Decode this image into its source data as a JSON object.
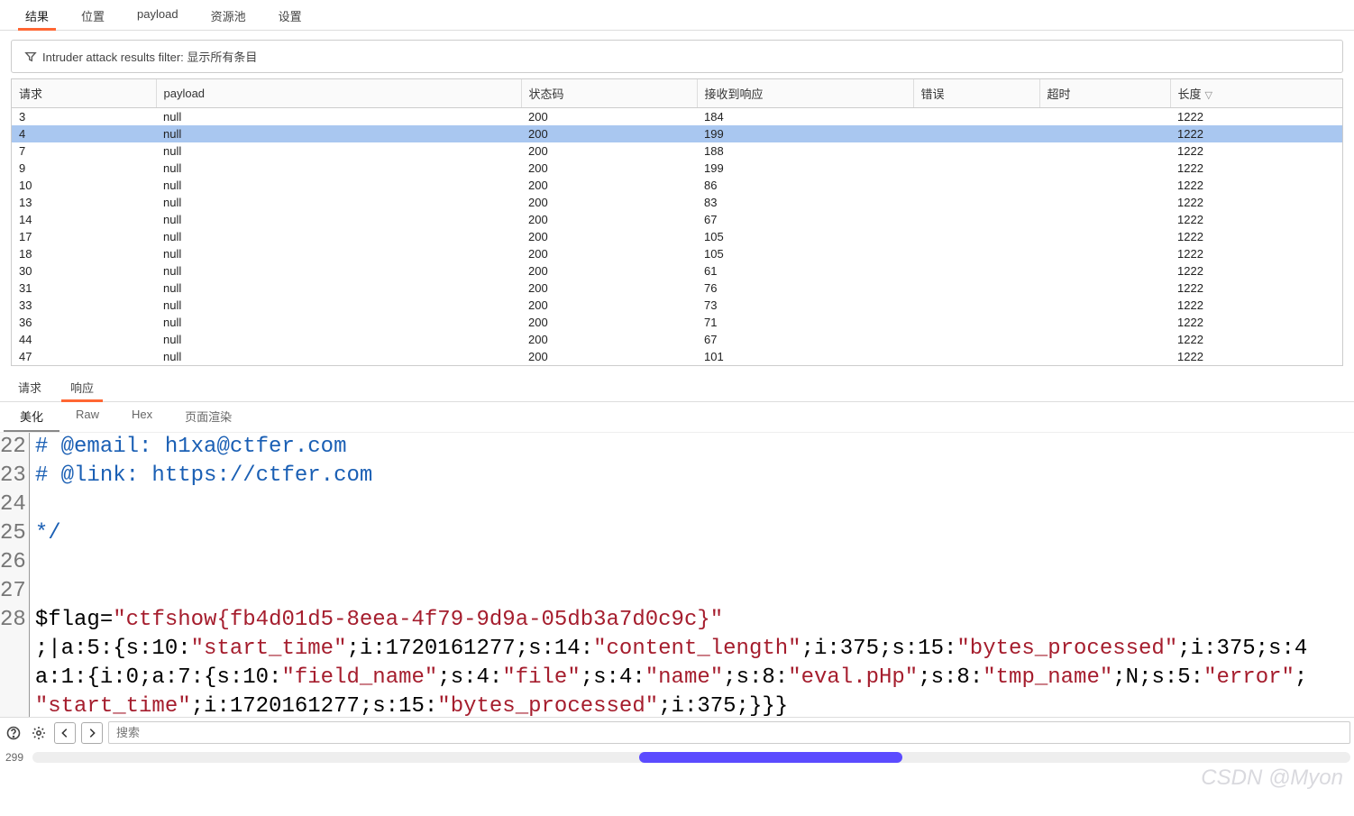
{
  "topTabs": [
    {
      "label": "结果",
      "active": true
    },
    {
      "label": "位置",
      "active": false
    },
    {
      "label": "payload",
      "active": false
    },
    {
      "label": "资源池",
      "active": false
    },
    {
      "label": "设置",
      "active": false
    }
  ],
  "filter": {
    "text": "Intruder attack results filter: 显示所有条目"
  },
  "columns": {
    "request": "请求",
    "payload": "payload",
    "status": "状态码",
    "received": "接收到响应",
    "error": "错误",
    "timeout": "超时",
    "length": "长度"
  },
  "sort": {
    "column": "length",
    "dir": "desc",
    "glyph": "▽"
  },
  "rows": [
    {
      "req": "3",
      "payload": "null",
      "status": "200",
      "recv": "184",
      "len": "1222",
      "selected": false
    },
    {
      "req": "4",
      "payload": "null",
      "status": "200",
      "recv": "199",
      "len": "1222",
      "selected": true
    },
    {
      "req": "7",
      "payload": "null",
      "status": "200",
      "recv": "188",
      "len": "1222",
      "selected": false
    },
    {
      "req": "9",
      "payload": "null",
      "status": "200",
      "recv": "199",
      "len": "1222",
      "selected": false
    },
    {
      "req": "10",
      "payload": "null",
      "status": "200",
      "recv": "86",
      "len": "1222",
      "selected": false
    },
    {
      "req": "13",
      "payload": "null",
      "status": "200",
      "recv": "83",
      "len": "1222",
      "selected": false
    },
    {
      "req": "14",
      "payload": "null",
      "status": "200",
      "recv": "67",
      "len": "1222",
      "selected": false
    },
    {
      "req": "17",
      "payload": "null",
      "status": "200",
      "recv": "105",
      "len": "1222",
      "selected": false
    },
    {
      "req": "18",
      "payload": "null",
      "status": "200",
      "recv": "105",
      "len": "1222",
      "selected": false
    },
    {
      "req": "30",
      "payload": "null",
      "status": "200",
      "recv": "61",
      "len": "1222",
      "selected": false
    },
    {
      "req": "31",
      "payload": "null",
      "status": "200",
      "recv": "76",
      "len": "1222",
      "selected": false
    },
    {
      "req": "33",
      "payload": "null",
      "status": "200",
      "recv": "73",
      "len": "1222",
      "selected": false
    },
    {
      "req": "36",
      "payload": "null",
      "status": "200",
      "recv": "71",
      "len": "1222",
      "selected": false
    },
    {
      "req": "44",
      "payload": "null",
      "status": "200",
      "recv": "67",
      "len": "1222",
      "selected": false
    },
    {
      "req": "47",
      "payload": "null",
      "status": "200",
      "recv": "101",
      "len": "1222",
      "selected": false
    }
  ],
  "subTabs": [
    {
      "label": "请求",
      "active": false
    },
    {
      "label": "响应",
      "active": true
    }
  ],
  "viewTabs": [
    {
      "label": "美化",
      "active": true
    },
    {
      "label": "Raw",
      "active": false
    },
    {
      "label": "Hex",
      "active": false
    },
    {
      "label": "页面渲染",
      "active": false
    }
  ],
  "code": {
    "startLine": 22,
    "lines": [
      {
        "n": "22",
        "html": "<span class='cmt'># @email: h1xa@ctfer.com</span>"
      },
      {
        "n": "23",
        "html": "<span class='cmt'># @link: https://ctfer.com</span>"
      },
      {
        "n": "24",
        "html": ""
      },
      {
        "n": "25",
        "html": "<span class='cmt'>*/</span>"
      },
      {
        "n": "26",
        "html": ""
      },
      {
        "n": "27",
        "html": ""
      },
      {
        "n": "28l1",
        "html": "<span class='var'>$flag=</span><span class='str'>\"ctfshow{fb4d01d5-8eea-4f79-9d9a-05db3a7d0c9c}\"</span>"
      },
      {
        "n": "28l2",
        "html": "<span class='plain'>;|a:5:{s:10:</span><span class='str'>\"start_time\"</span><span class='plain'>;i:1720161277;s:14:</span><span class='str'>\"content_length\"</span><span class='plain'>;i:375;s:15:</span><span class='str'>\"bytes_processed\"</span><span class='plain'>;i:375;s:4</span>"
      },
      {
        "n": "28l3",
        "html": "<span class='plain'>a:1:{i:0;a:7:{s:10:</span><span class='str'>\"field_name\"</span><span class='plain'>;s:4:</span><span class='str'>\"file\"</span><span class='plain'>;s:4:</span><span class='str'>\"name\"</span><span class='plain'>;s:8:</span><span class='str'>\"eval.pHp\"</span><span class='plain'>;s:8:</span><span class='str'>\"tmp_name\"</span><span class='plain'>;N;s:5:</span><span class='str'>\"error\"</span><span class='plain'>;</span>"
      },
      {
        "n": "28l4",
        "html": "<span class='str'>\"start_time\"</span><span class='plain'>;i:1720161277;s:15:</span><span class='str'>\"bytes_processed\"</span><span class='plain'>;i:375;}}}</span>"
      }
    ],
    "gutter": [
      "22",
      "23",
      "24",
      "25",
      "26",
      "27",
      "28",
      "",
      "",
      ""
    ]
  },
  "search": {
    "placeholder": "搜索"
  },
  "footer": {
    "lineCount": "299"
  },
  "watermark": "CSDN @Myon"
}
